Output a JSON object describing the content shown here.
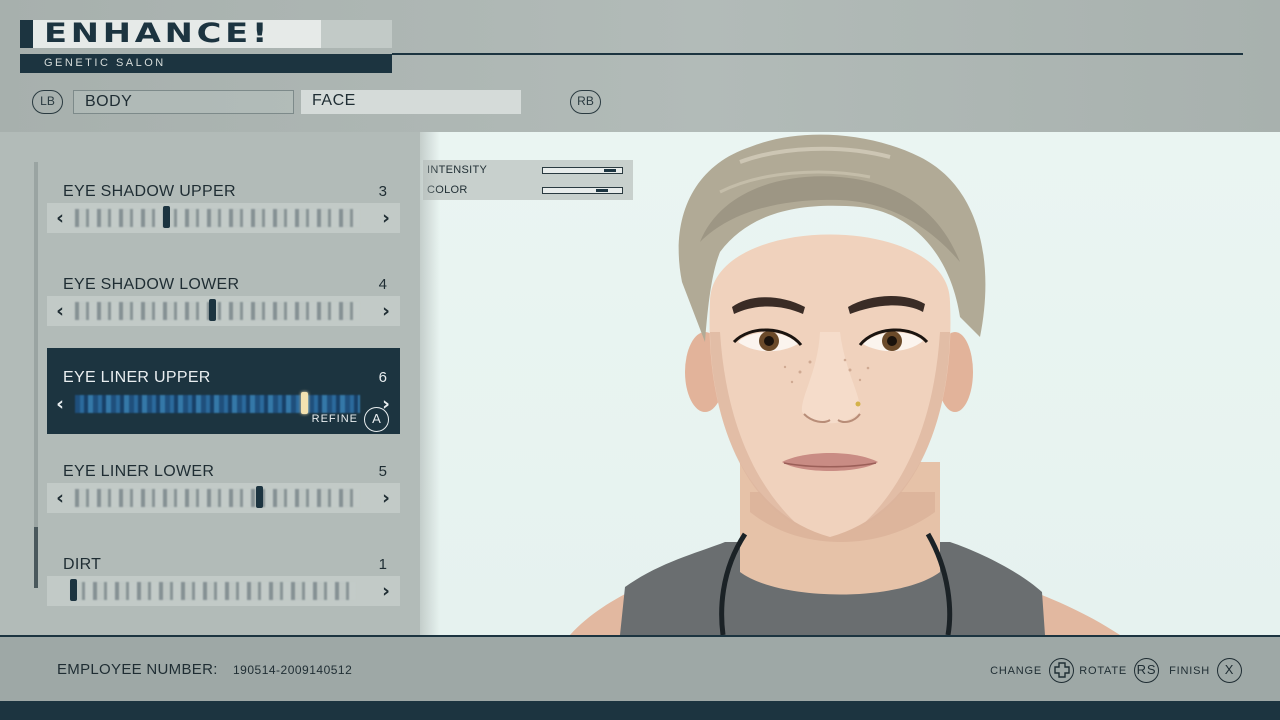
{
  "app": {
    "title": "ENHANCE!",
    "subtitle": "GENETIC SALON"
  },
  "nav": {
    "prev_button": "LB",
    "next_button": "RB",
    "tabs": [
      {
        "label": "BODY",
        "active": false
      },
      {
        "label": "FACE",
        "active": true
      }
    ]
  },
  "sliders": [
    {
      "label": "EYE SHADOW UPPER",
      "value": "3",
      "selected": false
    },
    {
      "label": "EYE SHADOW LOWER",
      "value": "4",
      "selected": false
    },
    {
      "label": "EYE LINER UPPER",
      "value": "6",
      "selected": true,
      "action_label": "REFINE",
      "action_button": "A"
    },
    {
      "label": "EYE LINER LOWER",
      "value": "5",
      "selected": false
    },
    {
      "label": "DIRT",
      "value": "1",
      "selected": false
    }
  ],
  "refine_panel": {
    "intensity_label": "INTENSITY",
    "intensity_level": 0.85,
    "color_label": "COLOR",
    "color_level": 0.75
  },
  "footer": {
    "employee_label": "EMPLOYEE NUMBER:",
    "employee_number": "190514-2009140512",
    "hints": [
      {
        "label": "CHANGE",
        "icon": "dpad-icon"
      },
      {
        "label": "ROTATE",
        "button": "RS"
      },
      {
        "label": "FINISH",
        "button": "X"
      }
    ]
  },
  "colors": {
    "accent_dark": "#1c3440",
    "panel": "#b2bbb8",
    "viewport_bg": "#eaf5f2",
    "selected_marker": "#f3e2b0"
  }
}
